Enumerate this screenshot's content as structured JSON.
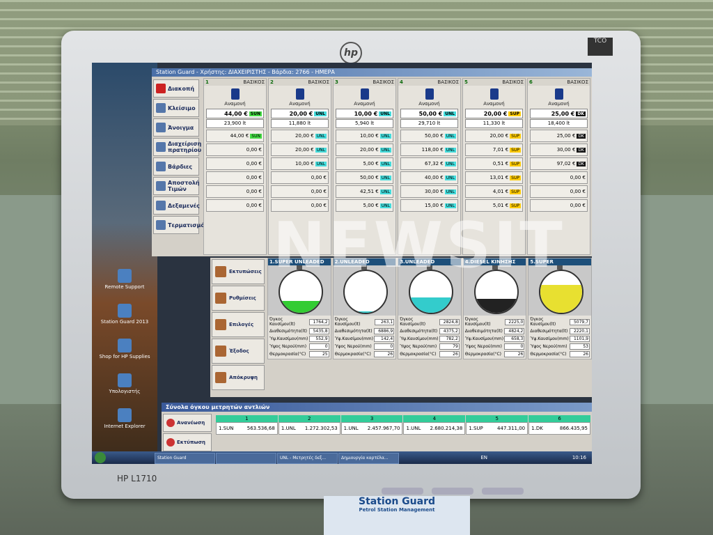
{
  "window_title": "Station Guard - Χρήστης: ΔΙΑΧΕΙΡΙΣΤΗΣ - Βάρδια: 2766 - ΗΜΕΡΑ",
  "monitor_model": "HP L1710",
  "brand_logo": "hp",
  "sidebar": [
    {
      "label": "Διακοπή",
      "icon": "stop-icon"
    },
    {
      "label": "Κλείσιμο",
      "icon": "lock-icon"
    },
    {
      "label": "Άνοιγμα",
      "icon": "nozzle-icon"
    },
    {
      "label": "Διαχείριση πρατηρίου",
      "icon": "station-icon"
    },
    {
      "label": "Βάρδιες",
      "icon": "people-icon"
    },
    {
      "label": "Αποστολή Τιμών",
      "icon": "send-icon"
    },
    {
      "label": "Δεξαμενές",
      "icon": "tank-icon"
    },
    {
      "label": "Τερματισμός",
      "icon": "exit-icon"
    }
  ],
  "pumps": [
    {
      "num": "1",
      "grade_label": "ΒΑΣΙΚΟΣ",
      "status": "Αναμονή",
      "amount": "44,00 €",
      "grade": "SUN",
      "liters": "23,900 lt",
      "presets": [
        {
          "v": "44,00 €",
          "g": "SUN"
        },
        {
          "v": "0,00 €",
          "g": ""
        },
        {
          "v": "0,00 €",
          "g": ""
        },
        {
          "v": "0,00 €",
          "g": ""
        },
        {
          "v": "0,00 €",
          "g": ""
        },
        {
          "v": "0,00 €",
          "g": ""
        }
      ]
    },
    {
      "num": "2",
      "grade_label": "ΒΑΣΙΚΟΣ",
      "status": "Αναμονή",
      "amount": "20,00 €",
      "grade": "UNL",
      "liters": "11,880 lt",
      "presets": [
        {
          "v": "20,00 €",
          "g": "UNL"
        },
        {
          "v": "20,00 €",
          "g": "UNL"
        },
        {
          "v": "10,00 €",
          "g": "UNL"
        },
        {
          "v": "0,00 €",
          "g": ""
        },
        {
          "v": "0,00 €",
          "g": ""
        },
        {
          "v": "0,00 €",
          "g": ""
        }
      ]
    },
    {
      "num": "3",
      "grade_label": "ΒΑΣΙΚΟΣ",
      "status": "Αναμονή",
      "amount": "10,00 €",
      "grade": "UNL",
      "liters": "5,940 lt",
      "presets": [
        {
          "v": "10,00 €",
          "g": "UNL"
        },
        {
          "v": "20,00 €",
          "g": "UNL"
        },
        {
          "v": "5,00 €",
          "g": "UNL"
        },
        {
          "v": "50,00 €",
          "g": "UNL"
        },
        {
          "v": "42,51 €",
          "g": "UNL"
        },
        {
          "v": "5,00 €",
          "g": "UNL"
        }
      ]
    },
    {
      "num": "4",
      "grade_label": "ΒΑΣΙΚΟΣ",
      "status": "Αναμονή",
      "amount": "50,00 €",
      "grade": "UNL",
      "liters": "29,710 lt",
      "presets": [
        {
          "v": "50,00 €",
          "g": "UNL"
        },
        {
          "v": "118,00 €",
          "g": "UNL"
        },
        {
          "v": "67,32 €",
          "g": "UNL"
        },
        {
          "v": "40,00 €",
          "g": "UNL"
        },
        {
          "v": "30,00 €",
          "g": "UNL"
        },
        {
          "v": "15,00 €",
          "g": "UNL"
        }
      ]
    },
    {
      "num": "5",
      "grade_label": "ΒΑΣΙΚΟΣ",
      "status": "Αναμονή",
      "amount": "20,00 €",
      "grade": "SUP",
      "liters": "11,330 lt",
      "presets": [
        {
          "v": "20,00 €",
          "g": "SUP"
        },
        {
          "v": "7,01 €",
          "g": "SUP"
        },
        {
          "v": "0,51 €",
          "g": "SUP"
        },
        {
          "v": "13,01 €",
          "g": "SUP"
        },
        {
          "v": "4,01 €",
          "g": "SUP"
        },
        {
          "v": "5,01 €",
          "g": "SUP"
        }
      ]
    },
    {
      "num": "6",
      "grade_label": "ΒΑΣΙΚΟΣ",
      "status": "Αναμονή",
      "amount": "25,00 €",
      "grade": "DK",
      "liters": "18,400 lt",
      "presets": [
        {
          "v": "25,00 €",
          "g": "DK"
        },
        {
          "v": "30,00 €",
          "g": "DK"
        },
        {
          "v": "97,02 €",
          "g": "DK"
        },
        {
          "v": "0,00 €",
          "g": ""
        },
        {
          "v": "0,00 €",
          "g": ""
        },
        {
          "v": "0,00 €",
          "g": ""
        }
      ]
    }
  ],
  "actions": [
    {
      "label": "Εκτυπώσεις"
    },
    {
      "label": "Ρυθμίσεις"
    },
    {
      "label": "Επιλογές"
    },
    {
      "label": "Έξοδος"
    },
    {
      "label": "Απόκρυψη"
    }
  ],
  "tanks": [
    {
      "name": "1.SUPER UNLEADED",
      "color": "#33cc33",
      "level": 0.28,
      "volume": "1764,2",
      "capacity": "5435,8",
      "fuel_height": "552,9",
      "water_height": "0",
      "temp": "25"
    },
    {
      "name": "2.UNLEADED",
      "color": "#33cccc",
      "level": 0.04,
      "volume": "263,1",
      "capacity": "6886,9",
      "fuel_height": "142,4",
      "water_height": "0",
      "temp": "26"
    },
    {
      "name": "3.UNLEADED",
      "color": "#33cccc",
      "level": 0.36,
      "volume": "2824,8",
      "capacity": "4375,2",
      "fuel_height": "782,2",
      "water_height": "79",
      "temp": "26"
    },
    {
      "name": "4.DIESEL ΚΙΝΗΣΗΣ",
      "color": "#222222",
      "level": 0.33,
      "volume": "2225,0",
      "capacity": "4824,2",
      "fuel_height": "658,3",
      "water_height": "0",
      "temp": "26"
    },
    {
      "name": "5.SUPER",
      "color": "#e8e030",
      "level": 0.66,
      "volume": "5079,7",
      "capacity": "2220,1",
      "fuel_height": "1101,9",
      "water_height": "53",
      "temp": "26"
    }
  ],
  "tank_labels": {
    "volume": "Όγκος Καυσίμου(lt)",
    "capacity": "Διαθεσιμότητα(lt)",
    "fuel_height": "Ύψ.Καυσίμου(mm)",
    "water_height": "Ύψος Νερού(mm)",
    "temp": "Θερμοκρασία(°C)"
  },
  "totals": {
    "title": "Σύνολα όγκου μετρητών αντλιών",
    "refresh": "Ανανέωση",
    "print": "Εκτύπωση",
    "columns": [
      {
        "h": "1",
        "code": "1.SUN",
        "v": "563.536,68"
      },
      {
        "h": "2",
        "code": "1.UNL",
        "v": "1.272.302,53"
      },
      {
        "h": "3",
        "code": "1.UNL",
        "v": "2.457.967,70"
      },
      {
        "h": "4",
        "code": "1.UNL",
        "v": "2.680.214,38"
      },
      {
        "h": "5",
        "code": "1.SUP",
        "v": "447.311,00"
      },
      {
        "h": "6",
        "code": "1.DK",
        "v": "866.435,95"
      }
    ]
  },
  "desktop_icons": [
    "Remote Support",
    "Station Guard 2013",
    "Shop for HP Supplies",
    "Υπολογιστής",
    "Internet Explorer"
  ],
  "taskbar": {
    "items": [
      "Station Guard",
      "",
      "UNL - Μετρητές δεξ...",
      "Δημιουργία καρτέλα..."
    ],
    "lang": "EN",
    "clock": "10:16"
  },
  "watermark": "NEWSIT",
  "below_brand": "Station Guard",
  "below_sub": "Petrol Station Management"
}
